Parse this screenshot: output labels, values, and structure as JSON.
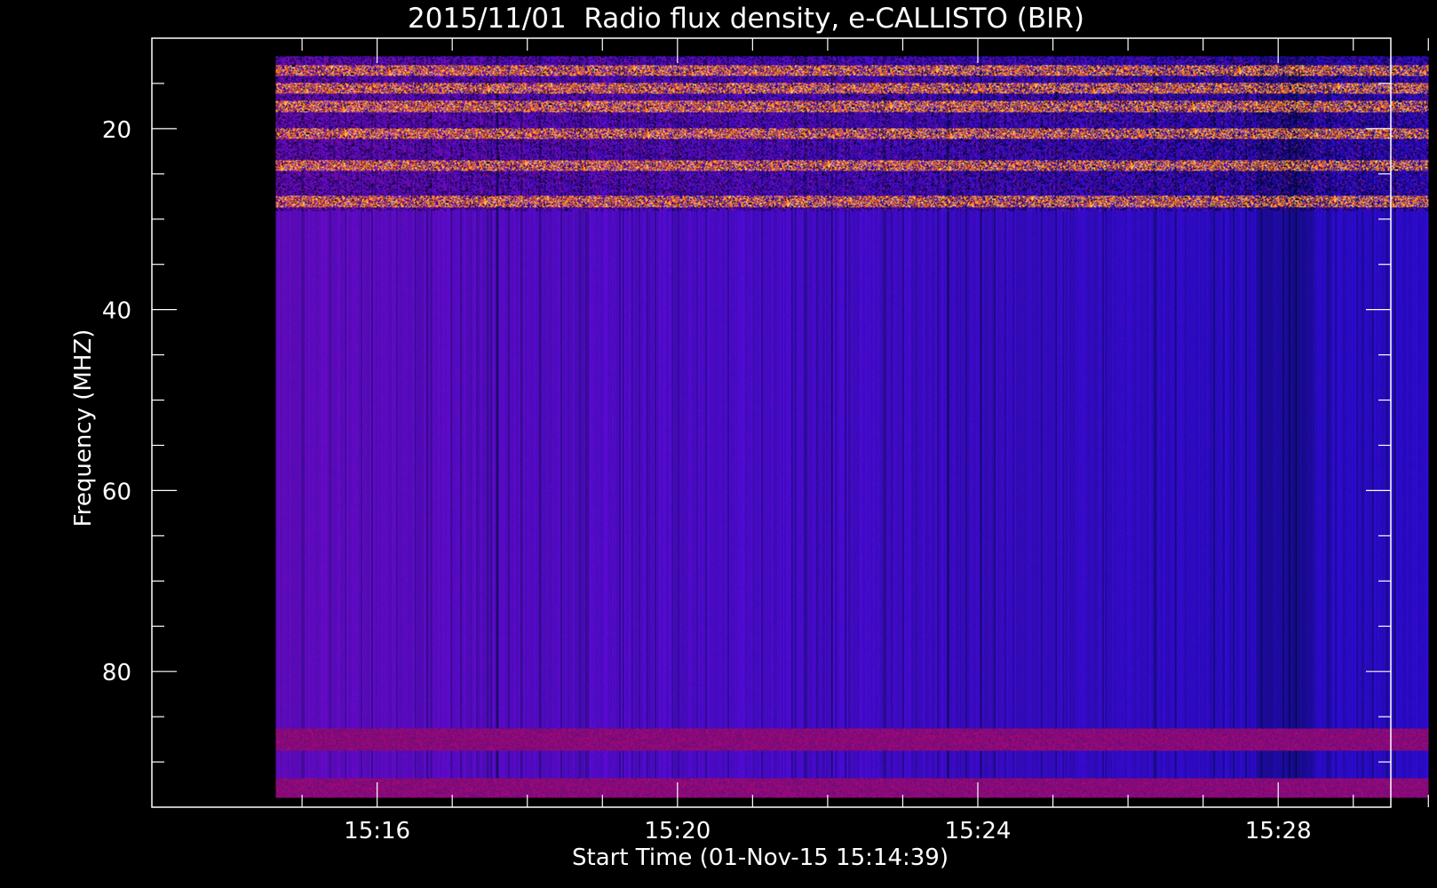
{
  "chart_data": {
    "type": "heatmap",
    "title": "2015/11/01  Radio flux density, e-CALLISTO (BIR)",
    "xlabel": "Start Time (01-Nov-15 15:14:39)",
    "ylabel": "Frequency (MHZ)",
    "x_tick_labels": [
      "15:16",
      "15:20",
      "15:24",
      "15:28"
    ],
    "x_ticks_min": [
      15.25,
      16,
      20,
      24,
      28,
      30
    ],
    "x_range_min": [
      13.0,
      29.5
    ],
    "x_data_range_min": [
      14.65,
      30.0
    ],
    "y_tick_labels": [
      "20",
      "40",
      "60",
      "80"
    ],
    "y_ticks": [
      20,
      40,
      60,
      80
    ],
    "y_range": [
      10,
      95
    ],
    "y_data_range": [
      12,
      94
    ],
    "y_inverted": true,
    "grid": false,
    "colormap": [
      "#000000",
      "#0000ff",
      "#b02040",
      "#ff4000",
      "#ffff80"
    ],
    "bright_bands_mhz": [
      13.5,
      15.5,
      17.5,
      20.5,
      24,
      28
    ],
    "dark_bands_mhz": [
      87.5,
      93
    ]
  }
}
